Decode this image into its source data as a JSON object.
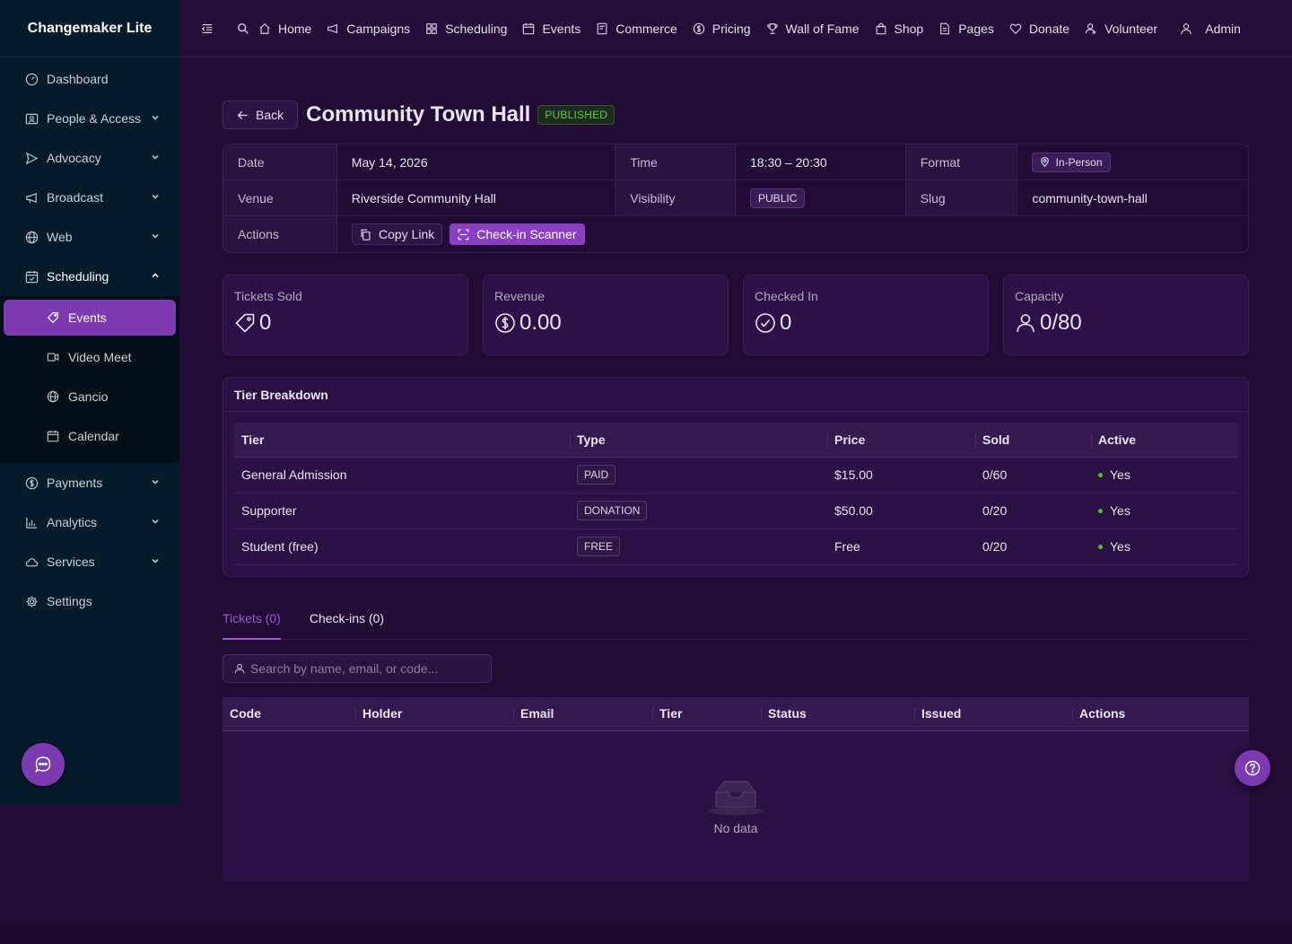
{
  "app": {
    "brand": "Changemaker Lite"
  },
  "sidebar": {
    "items": [
      {
        "label": "Dashboard",
        "icon": "dashboard-icon"
      },
      {
        "label": "People & Access",
        "icon": "contacts-icon"
      },
      {
        "label": "Advocacy",
        "icon": "send-icon"
      },
      {
        "label": "Broadcast",
        "icon": "megaphone-icon"
      },
      {
        "label": "Web",
        "icon": "globe-icon"
      },
      {
        "label": "Scheduling",
        "icon": "calendar-check-icon"
      },
      {
        "label": "Payments",
        "icon": "dollar-circle-icon"
      },
      {
        "label": "Analytics",
        "icon": "bar-chart-icon"
      },
      {
        "label": "Services",
        "icon": "cloud-icon"
      },
      {
        "label": "Settings",
        "icon": "gear-icon"
      }
    ],
    "scheduling_sub": [
      {
        "label": "Events",
        "icon": "tag-icon",
        "active": true
      },
      {
        "label": "Video Meet",
        "icon": "video-icon"
      },
      {
        "label": "Gancio",
        "icon": "globe-icon"
      },
      {
        "label": "Calendar",
        "icon": "calendar-icon"
      }
    ]
  },
  "topbar": {
    "items": [
      {
        "label": "Home"
      },
      {
        "label": "Campaigns"
      },
      {
        "label": "Scheduling"
      },
      {
        "label": "Events"
      },
      {
        "label": "Commerce"
      },
      {
        "label": "Pricing"
      },
      {
        "label": "Wall of Fame"
      },
      {
        "label": "Shop"
      },
      {
        "label": "Pages"
      },
      {
        "label": "Donate"
      },
      {
        "label": "Volunteer"
      }
    ],
    "user": "Admin"
  },
  "event": {
    "back_label": "Back",
    "title": "Community Town Hall",
    "status": "PUBLISHED",
    "details": {
      "date_label": "Date",
      "date": "May 14, 2026",
      "time_label": "Time",
      "time": "18:30 – 20:30",
      "format_label": "Format",
      "format": "In-Person",
      "venue_label": "Venue",
      "venue": "Riverside Community Hall",
      "visibility_label": "Visibility",
      "visibility": "PUBLIC",
      "slug_label": "Slug",
      "slug": "community-town-hall",
      "actions_label": "Actions",
      "copy_link": "Copy Link",
      "scanner": "Check-in Scanner"
    }
  },
  "stats": {
    "tickets_sold": {
      "title": "Tickets Sold",
      "value": "0"
    },
    "revenue": {
      "title": "Revenue",
      "value": "0.00"
    },
    "checked_in": {
      "title": "Checked In",
      "value": "0"
    },
    "capacity": {
      "title": "Capacity",
      "value": "0/80"
    }
  },
  "tiers": {
    "title": "Tier Breakdown",
    "columns": [
      "Tier",
      "Type",
      "Price",
      "Sold",
      "Active"
    ],
    "rows": [
      {
        "tier": "General Admission",
        "type": "PAID",
        "price": "$15.00",
        "sold": "0/60",
        "active": "Yes"
      },
      {
        "tier": "Supporter",
        "type": "DONATION",
        "price": "$50.00",
        "sold": "0/20",
        "active": "Yes"
      },
      {
        "tier": "Student (free)",
        "type": "FREE",
        "price": "Free",
        "sold": "0/20",
        "active": "Yes"
      }
    ]
  },
  "tabs": [
    {
      "label": "Tickets (0)",
      "active": true
    },
    {
      "label": "Check-ins (0)"
    }
  ],
  "tickets": {
    "search_placeholder": "Search by name, email, or code...",
    "columns": [
      "Code",
      "Holder",
      "Email",
      "Tier",
      "Status",
      "Issued",
      "Actions"
    ],
    "empty_text": "No data"
  },
  "colors": {
    "accent": "#7b3ab0",
    "active_dot": "#52c41a",
    "published": "#5fcf3a"
  }
}
